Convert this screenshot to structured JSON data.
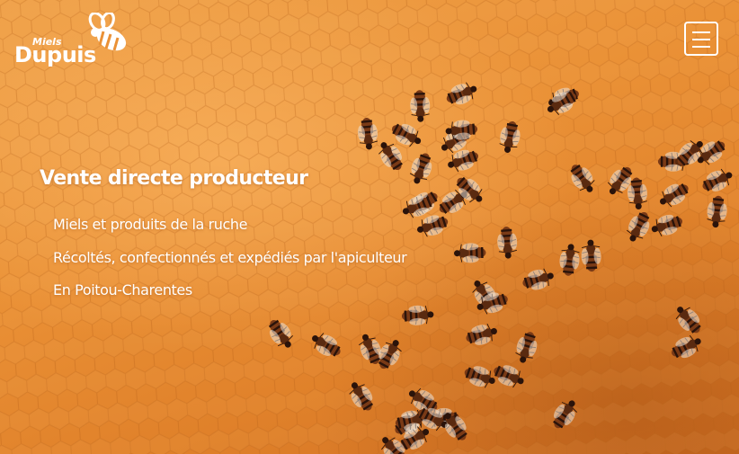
{
  "brand": {
    "small": "Miels",
    "big": "Dupuis"
  },
  "menu": {
    "icon": "hamburger-menu-icon"
  },
  "hero": {
    "headline": "Vente directe producteur",
    "features": [
      "Miels et produits de la ruche",
      "Récoltés, confectionnés et expédiés par l'apiculteur",
      "En Poitou-Charentes"
    ],
    "background_image": "honeybees-on-honeycomb",
    "colors": {
      "honey": "#ea9136",
      "text": "#ffffff"
    }
  }
}
